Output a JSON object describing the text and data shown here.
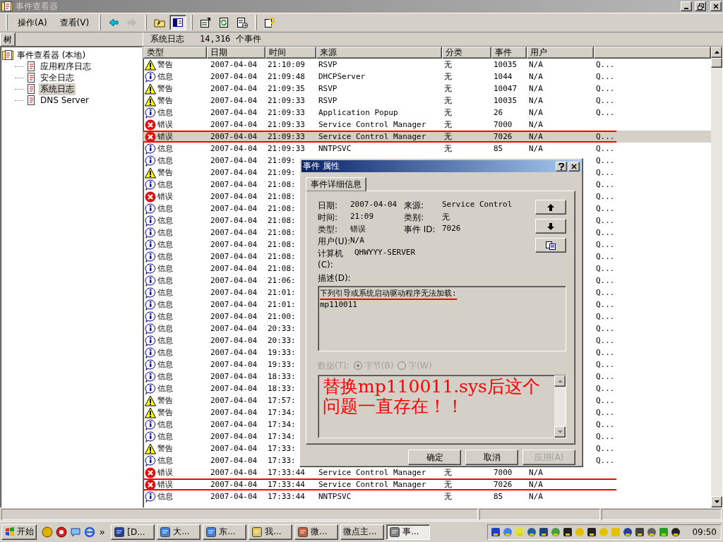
{
  "window": {
    "title": "事件查看器"
  },
  "menus": [
    {
      "label": "操作(A)"
    },
    {
      "label": "查看(V)"
    }
  ],
  "toolbar": [
    {
      "kind": "back",
      "disabled": false,
      "pressed": false
    },
    {
      "kind": "forward",
      "disabled": true,
      "pressed": false
    },
    {
      "kind": "up",
      "disabled": false,
      "pressed": false
    },
    {
      "kind": "tree",
      "disabled": false,
      "pressed": true
    },
    {
      "kind": "properties",
      "disabled": false,
      "pressed": false
    },
    {
      "kind": "refresh",
      "disabled": false,
      "pressed": false
    },
    {
      "kind": "export",
      "disabled": false,
      "pressed": false
    },
    {
      "kind": "help",
      "disabled": false,
      "pressed": false
    }
  ],
  "tree": {
    "tab": "树",
    "items": [
      {
        "label": "事件查看器 (本地)",
        "selected": false,
        "children": [
          {
            "label": "应用程序日志",
            "selected": false
          },
          {
            "label": "安全日志",
            "selected": false
          },
          {
            "label": "系统日志",
            "selected": true
          },
          {
            "label": "DNS Server",
            "selected": false
          }
        ]
      }
    ]
  },
  "list": {
    "title": "系统日志",
    "count": "14,316 个事件",
    "columns": [
      "类型",
      "日期",
      "时间",
      "来源",
      "分类",
      "事件",
      "用户"
    ],
    "rows": [
      {
        "kind": "warning",
        "type": "警告",
        "date": "2007-04-04",
        "time": "21:10:09",
        "source": "RSVP",
        "category": "无",
        "event": "10035",
        "user": "N/A",
        "column_8": "Q...",
        "selected": false,
        "marked": false
      },
      {
        "kind": "info",
        "type": "信息",
        "date": "2007-04-04",
        "time": "21:09:48",
        "source": "DHCPServer",
        "category": "无",
        "event": "1044",
        "user": "N/A",
        "column_8": "Q...",
        "selected": false,
        "marked": false
      },
      {
        "kind": "warning",
        "type": "警告",
        "date": "2007-04-04",
        "time": "21:09:35",
        "source": "RSVP",
        "category": "无",
        "event": "10047",
        "user": "N/A",
        "column_8": "Q...",
        "selected": false,
        "marked": false
      },
      {
        "kind": "warning",
        "type": "警告",
        "date": "2007-04-04",
        "time": "21:09:33",
        "source": "RSVP",
        "category": "无",
        "event": "10035",
        "user": "N/A",
        "column_8": "Q...",
        "selected": false,
        "marked": false
      },
      {
        "kind": "info",
        "type": "信息",
        "date": "2007-04-04",
        "time": "21:09:33",
        "source": "Application Popup",
        "category": "无",
        "event": "26",
        "user": "N/A",
        "column_8": "Q...",
        "selected": false,
        "marked": false
      },
      {
        "kind": "error",
        "type": "错误",
        "date": "2007-04-04",
        "time": "21:09:33",
        "source": "Service Control Manager",
        "category": "无",
        "event": "7000",
        "user": "N/A",
        "selected": false,
        "marked": false
      },
      {
        "kind": "error",
        "type": "错误",
        "date": "2007-04-04",
        "time": "21:09:33",
        "source": "Service Control Manager",
        "category": "无",
        "event": "7026",
        "user": "N/A",
        "column_8": "Q...",
        "selected": true,
        "marked": true
      },
      {
        "kind": "info",
        "type": "信息",
        "date": "2007-04-04",
        "time": "21:09:33",
        "source": "NNTPSVC",
        "category": "无",
        "event": "85",
        "user": "N/A",
        "column_8": "Q...",
        "selected": false,
        "marked": false
      },
      {
        "kind": "info",
        "type": "信息",
        "date": "2007-04-04",
        "time": "21:09:",
        "column_8": "Q...",
        "selected": false,
        "marked": false
      },
      {
        "kind": "warning",
        "type": "警告",
        "date": "2007-04-04",
        "time": "21:09:",
        "column_8": "Q...",
        "selected": false,
        "marked": false
      },
      {
        "kind": "info",
        "type": "信息",
        "date": "2007-04-04",
        "time": "21:08:",
        "column_8": "Q...",
        "selected": false,
        "marked": false
      },
      {
        "kind": "error",
        "type": "错误",
        "date": "2007-04-04",
        "time": "21:08:",
        "column_8": "Q...",
        "selected": false,
        "marked": false
      },
      {
        "kind": "info",
        "type": "信息",
        "date": "2007-04-04",
        "time": "21:08:",
        "column_8": "Q...",
        "selected": false,
        "marked": false
      },
      {
        "kind": "info",
        "type": "信息",
        "date": "2007-04-04",
        "time": "21:08:",
        "column_8": "Q...",
        "selected": false,
        "marked": false
      },
      {
        "kind": "info",
        "type": "信息",
        "date": "2007-04-04",
        "time": "21:08:",
        "column_8": "Q...",
        "selected": false,
        "marked": false
      },
      {
        "kind": "info",
        "type": "信息",
        "date": "2007-04-04",
        "time": "21:08:",
        "column_8": "Q...",
        "selected": false,
        "marked": false
      },
      {
        "kind": "info",
        "type": "信息",
        "date": "2007-04-04",
        "time": "21:08:",
        "column_8": "Q...",
        "selected": false,
        "marked": false
      },
      {
        "kind": "info",
        "type": "信息",
        "date": "2007-04-04",
        "time": "21:08:",
        "column_8": "Q...",
        "selected": false,
        "marked": false
      },
      {
        "kind": "info",
        "type": "信息",
        "date": "2007-04-04",
        "time": "21:06:",
        "column_8": "Q...",
        "selected": false,
        "marked": false
      },
      {
        "kind": "info",
        "type": "信息",
        "date": "2007-04-04",
        "time": "21:01:",
        "column_8": "Q...",
        "selected": false,
        "marked": false
      },
      {
        "kind": "info",
        "type": "信息",
        "date": "2007-04-04",
        "time": "21:01:",
        "column_8": "Q...",
        "selected": false,
        "marked": false
      },
      {
        "kind": "info",
        "type": "信息",
        "date": "2007-04-04",
        "time": "21:00:",
        "column_8": "Q...",
        "selected": false,
        "marked": false
      },
      {
        "kind": "info",
        "type": "信息",
        "date": "2007-04-04",
        "time": "20:33:",
        "column_8": "Q...",
        "selected": false,
        "marked": false
      },
      {
        "kind": "info",
        "type": "信息",
        "date": "2007-04-04",
        "time": "20:33:",
        "column_8": "Q...",
        "selected": false,
        "marked": false
      },
      {
        "kind": "info",
        "type": "信息",
        "date": "2007-04-04",
        "time": "19:33:",
        "column_8": "Q...",
        "selected": false,
        "marked": false
      },
      {
        "kind": "info",
        "type": "信息",
        "date": "2007-04-04",
        "time": "19:33:",
        "column_8": "Q...",
        "selected": false,
        "marked": false
      },
      {
        "kind": "info",
        "type": "信息",
        "date": "2007-04-04",
        "time": "18:33:",
        "column_8": "Q...",
        "selected": false,
        "marked": false
      },
      {
        "kind": "info",
        "type": "信息",
        "date": "2007-04-04",
        "time": "18:33:",
        "column_8": "Q...",
        "selected": false,
        "marked": false
      },
      {
        "kind": "warning",
        "type": "警告",
        "date": "2007-04-04",
        "time": "17:57:",
        "column_8": "Q...",
        "selected": false,
        "marked": false
      },
      {
        "kind": "warning",
        "type": "警告",
        "date": "2007-04-04",
        "time": "17:34:",
        "column_8": "Q...",
        "selected": false,
        "marked": false
      },
      {
        "kind": "info",
        "type": "信息",
        "date": "2007-04-04",
        "time": "17:34:",
        "column_8": "Q...",
        "selected": false,
        "marked": false
      },
      {
        "kind": "info",
        "type": "信息",
        "date": "2007-04-04",
        "time": "17:34:",
        "column_8": "Q...",
        "selected": false,
        "marked": false
      },
      {
        "kind": "warning",
        "type": "警告",
        "date": "2007-04-04",
        "time": "17:33:",
        "column_8": "Q...",
        "selected": false,
        "marked": false
      },
      {
        "kind": "info",
        "type": "信息",
        "date": "2007-04-04",
        "time": "17:33:",
        "column_8": "Q...",
        "selected": false,
        "marked": false
      },
      {
        "kind": "error",
        "type": "错误",
        "date": "2007-04-04",
        "time": "17:33:44",
        "source": "Service Control Manager",
        "category": "无",
        "event": "7000",
        "user": "N/A",
        "selected": false,
        "marked": false
      },
      {
        "kind": "error",
        "type": "错误",
        "date": "2007-04-04",
        "time": "17:33:44",
        "source": "Service Control Manager",
        "category": "无",
        "event": "7026",
        "user": "N/A",
        "selected": false,
        "marked": true
      },
      {
        "kind": "info",
        "type": "信息",
        "date": "2007-04-04",
        "time": "17:33:44",
        "source": "NNTPSVC",
        "category": "无",
        "event": "85",
        "user": "N/A",
        "selected": false,
        "marked": false
      }
    ]
  },
  "dialog": {
    "title": "事件 属性",
    "tabs": [
      {
        "label": "事件详细信息",
        "selected": true
      }
    ],
    "field_rows": [
      [
        {
          "label": "日期:",
          "value": "2007-04-04"
        },
        {
          "label": "来源:",
          "value": "Service Control"
        }
      ],
      [
        {
          "label": "时间:",
          "value": "21:09"
        },
        {
          "label": "类别:",
          "value": "无"
        }
      ],
      [
        {
          "label": "类型:",
          "value": "错误"
        },
        {
          "label": "事件 ID:",
          "value": "7026"
        }
      ],
      [
        {
          "label": "用户(U):",
          "value": "N/A"
        }
      ],
      [
        {
          "label": "计算机(C):",
          "value": "QHWYYY-SERVER"
        }
      ]
    ],
    "description_label": "描述(D):",
    "description": [
      {
        "text": "下列引导或系统启动驱动程序无法加载:",
        "marked": true
      },
      {
        "text": "mp110011",
        "marked": false
      }
    ],
    "data_label": "数据(T):",
    "data_disabled": true,
    "data_formats": [
      {
        "label": "字节(B)",
        "selected": true
      },
      {
        "label": "字(W)",
        "selected": false
      }
    ],
    "data_note": "替换mp110011.sys后这个问题一直存在！！",
    "buttons": [
      {
        "label": "确定",
        "disabled": false
      },
      {
        "label": "取消",
        "disabled": false
      },
      {
        "label": "应用(A)",
        "disabled": true
      }
    ]
  },
  "taskbar": {
    "start": "开始",
    "more": "»",
    "tasks": [
      {
        "label": "[D...",
        "selected": false
      },
      {
        "label": "大...",
        "selected": false
      },
      {
        "label": "东...",
        "selected": false
      },
      {
        "label": "我...",
        "selected": false
      },
      {
        "label": "微...",
        "selected": false
      },
      {
        "label": "微点主...",
        "selected": false
      },
      {
        "label": "事...",
        "selected": true
      }
    ],
    "clock": "09:50"
  }
}
